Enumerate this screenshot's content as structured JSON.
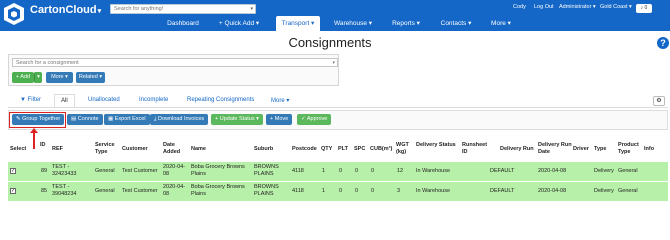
{
  "app": {
    "name": "CartonCloud"
  },
  "header": {
    "search_placeholder": "Search for anything!",
    "user_links": [
      "Cody",
      "Log Out",
      "Administrator",
      "Gold Coast"
    ],
    "notifications": "0"
  },
  "menu": [
    {
      "label": "Dashboard"
    },
    {
      "label": "+ Quick Add"
    },
    {
      "label": "Transport"
    },
    {
      "label": "Warehouse"
    },
    {
      "label": "Reports"
    },
    {
      "label": "Contacts"
    },
    {
      "label": "More"
    }
  ],
  "page": {
    "title": "Consignments"
  },
  "search": {
    "placeholder": "Search for a consignment"
  },
  "buttons": {
    "add": "+ Add",
    "more": "More",
    "related": "Related"
  },
  "tabs": [
    "Filter",
    "All",
    "Unallocated",
    "Incomplete",
    "Repeating Consignments",
    "More"
  ],
  "actions": [
    "Group Together",
    "Connote",
    "Export Excel",
    "Download Invoices",
    "Update Status",
    "Move",
    "Approve"
  ],
  "table": {
    "columns": [
      "Select",
      "ID",
      "REF",
      "Service Type",
      "Customer",
      "Date Added",
      "Name",
      "Suburb",
      "Postcode",
      "QTY",
      "PLT",
      "SPC",
      "CUB(m³)",
      "WGT (kg)",
      "Delivery Status",
      "Runsheet ID",
      "Delivery Run",
      "Delivery Run Date",
      "Driver",
      "Type",
      "Product Type",
      "Info"
    ],
    "rows": [
      {
        "id": "89",
        "ref": "TEST - 32423433",
        "service": "General",
        "customer": "Test Customer",
        "date": "2020-04-08",
        "name": "Boba Grocery Browns Plains",
        "suburb": "BROWNS PLAINS",
        "postcode": "4118",
        "qty": "1",
        "plt": "0",
        "spc": "0",
        "cub": "0",
        "wgt": "12",
        "status": "In Warehouse",
        "runsheet": "",
        "run": "DEFAULT",
        "run_date": "2020-04-08",
        "driver": "",
        "type": "Delivery",
        "product": "General",
        "info": ""
      },
      {
        "id": "85",
        "ref": "TEST - 39048234",
        "service": "General",
        "customer": "Test Customer",
        "date": "2020-04-08",
        "name": "Boba Grocery Browns Plains",
        "suburb": "BROWNS PLAINS",
        "postcode": "4118",
        "qty": "1",
        "plt": "0",
        "spc": "0",
        "cub": "0",
        "wgt": "3",
        "status": "In Warehouse",
        "runsheet": "",
        "run": "DEFAULT",
        "run_date": "2020-04-08",
        "driver": "",
        "type": "Delivery",
        "product": "General",
        "info": ""
      }
    ]
  },
  "colors": {
    "navbar": "#1467c7",
    "row_highlight": "#b7f0a8",
    "annotation": "#dd2222"
  }
}
